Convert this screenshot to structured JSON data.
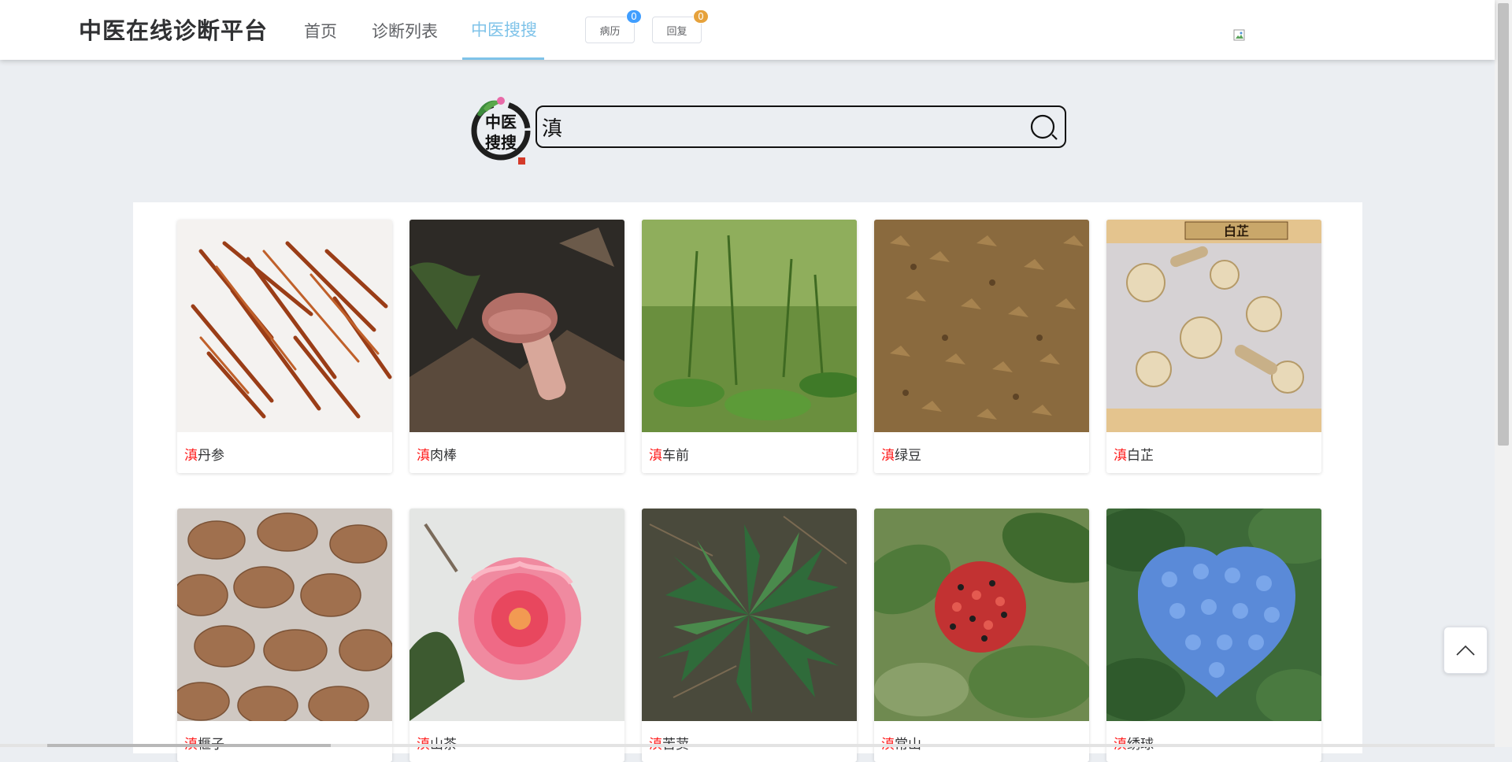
{
  "header": {
    "brand": "中医在线诊断平台",
    "nav": [
      {
        "label": "首页"
      },
      {
        "label": "诊断列表"
      },
      {
        "label": "中医搜搜"
      }
    ],
    "buttons": [
      {
        "label": "病历",
        "badge": "0",
        "badge_color": "#409eff"
      },
      {
        "label": "回复",
        "badge": "0",
        "badge_color": "#e6a23c"
      }
    ],
    "accent_color": "#7fc3e9"
  },
  "search": {
    "value": "滇",
    "logo_text": "中医搜搜"
  },
  "results": [
    {
      "prefix": "滇",
      "name": "丹参",
      "image": "dried-red-roots"
    },
    {
      "prefix": "滇",
      "name": "肉棒",
      "image": "mushroom"
    },
    {
      "prefix": "滇",
      "name": "车前",
      "image": "green-plants"
    },
    {
      "prefix": "滇",
      "name": "绿豆",
      "image": "brown-seeds"
    },
    {
      "prefix": "滇",
      "name": "白芷",
      "image": "root-slices"
    },
    {
      "prefix": "滇",
      "name": "榧子",
      "image": "brown-nuts"
    },
    {
      "prefix": "滇",
      "name": "山茶",
      "image": "pink-camellia"
    },
    {
      "prefix": "滇",
      "name": "苦荬",
      "image": "thistle-plant"
    },
    {
      "prefix": "滇",
      "name": "常山",
      "image": "red-berries"
    },
    {
      "prefix": "滇",
      "name": "绣球",
      "image": "blue-hydrangea"
    }
  ],
  "root_slices_label": "白芷"
}
